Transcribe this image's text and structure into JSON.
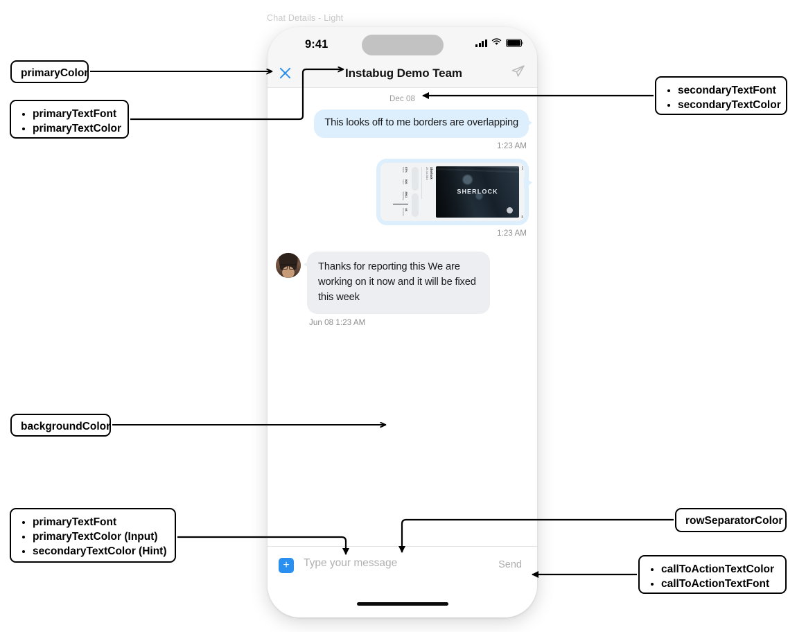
{
  "caption": "Chat Details - Light",
  "phone": {
    "status_bar": {
      "time": "9:41",
      "icons": [
        "cellular-signal-icon",
        "wifi-icon",
        "battery-icon"
      ]
    },
    "nav_bar": {
      "close_icon": "close-icon",
      "title": "Instabug Demo Team",
      "action_icon": "send-plane-icon"
    },
    "conversation": {
      "day_separator": "Dec 08",
      "messages": [
        {
          "id": "msg-text-outgoing",
          "direction": "outgoing",
          "type": "text",
          "text": "This looks off to me borders are overlapping",
          "timestamp": "1:23 AM"
        },
        {
          "id": "msg-image-outgoing",
          "direction": "outgoing",
          "type": "image",
          "attachment": {
            "name": "sherlock-screenshot-attachment",
            "poster_title": "SHERLOCK",
            "detail_title": "Sherlock",
            "detail_sub": "25 Jul 2010",
            "stat_labels": [
              "46 Reviews",
              "8941 Watching",
              "826 Seen",
              "87% Match"
            ],
            "pill_labels": [
              "Watch",
              "Download"
            ]
          },
          "timestamp": "1:23 AM"
        },
        {
          "id": "msg-text-incoming",
          "direction": "incoming",
          "type": "text",
          "avatar": "agent-avatar",
          "text": "Thanks for reporting this We are working on it now and it will be fixed this week",
          "timestamp": "Jun 08 1:23 AM"
        }
      ]
    },
    "composer": {
      "attach_label": "+",
      "input_value": "",
      "input_placeholder": "Type your message",
      "send_label": "Send"
    }
  },
  "annotations": [
    {
      "id": "primary-color",
      "lines": [
        "primaryColor"
      ],
      "bulleted": false
    },
    {
      "id": "primary-text",
      "lines": [
        "primaryTextFont",
        "primaryTextColor"
      ],
      "bulleted": true
    },
    {
      "id": "secondary-text",
      "lines": [
        "secondaryTextFont",
        "secondaryTextColor"
      ],
      "bulleted": true
    },
    {
      "id": "background-color",
      "lines": [
        "backgroundColor"
      ],
      "bulleted": false
    },
    {
      "id": "input-text",
      "lines": [
        "primaryTextFont",
        "primaryTextColor (Input)",
        "secondaryTextColor (Hint)"
      ],
      "bulleted": true
    },
    {
      "id": "row-separator-color",
      "lines": [
        "rowSeparatorColor"
      ],
      "bulleted": false
    },
    {
      "id": "call-to-action",
      "lines": [
        "callToActionTextColor",
        "callToActionTextFont"
      ],
      "bulleted": true
    }
  ],
  "colors": {
    "accent_blue": "#2a8fee",
    "outgoing_bubble": "#ddeffc",
    "incoming_bubble": "#eceef2",
    "secondary_text": "#8e8e8e",
    "separator": "#e4e4e4",
    "annotation_border": "#000000"
  }
}
